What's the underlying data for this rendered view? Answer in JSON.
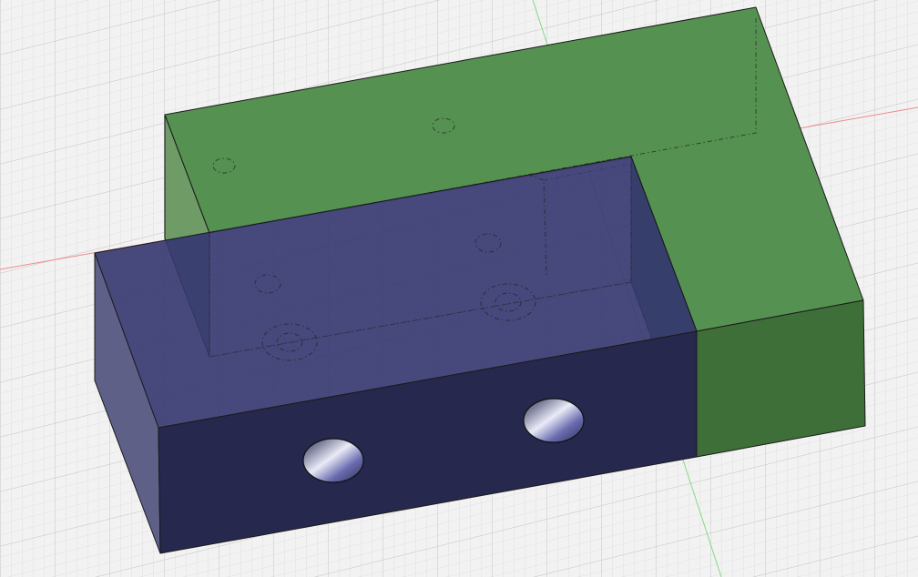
{
  "viewport": {
    "background": "#f2f2f2",
    "grid_minor_color": "#d9d9d9",
    "grid_major_color": "#c4c4c4",
    "x_axis_color": "#f08080",
    "y_axis_color": "#7fd67f"
  },
  "bodies": [
    {
      "name": "green-l-bracket",
      "top_color": "#559150",
      "side_color": "#5f9c58",
      "front_color": "#3f6f39",
      "hidden_edge_color": "#2b4a27"
    },
    {
      "name": "blue-block",
      "top_color": "#3b3d6e",
      "side_color": "#5a5c85",
      "front_color": "#26284d",
      "hole_color": "#e6e8f5"
    }
  ]
}
